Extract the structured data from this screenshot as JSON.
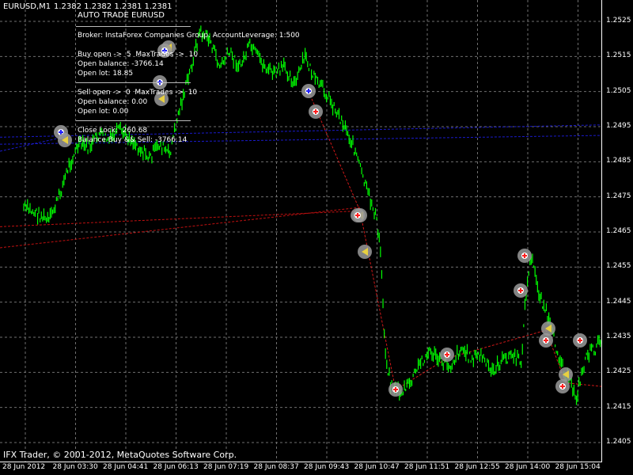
{
  "header": {
    "symbol": "EURUSD,M1",
    "ohlc": "1.2382 1.2382 1.2381 1.2381"
  },
  "ea": {
    "title": "AUTO TRADE EURUSD",
    "broker": "Broker: InstaForex Companies Group. AccountLeverage: 1:500",
    "buy_open": "Buy open ->  5  MaxTrades ->  10",
    "buy_balance": "Open balance: -3766.14",
    "buy_lot": "Open lot: 18.85",
    "sell_open": "Sell open ->  0  MaxTrades ->  10",
    "sell_balance": "Open balance: 0.00",
    "sell_lot": "Open lot: 0.00",
    "close_lock": "Close Lock:  260.68",
    "balance": "Balance Buy && Sell: -3766.14"
  },
  "copyright": "IFX Trader, © 2001-2012, MetaQuotes Software Corp.",
  "colors": {
    "bg": "#000000",
    "grid": "#6f6f6f",
    "candle": "#00ff00",
    "buy": "#1f1fff",
    "sell": "#ff2020"
  },
  "y_labels": [
    "1.2525",
    "1.2515",
    "1.2505",
    "1.2495",
    "1.2485",
    "1.2475",
    "1.2465",
    "1.2455",
    "1.2445",
    "1.2435",
    "1.2425",
    "1.2415",
    "1.2405"
  ],
  "x_labels": [
    "28 Jun 2012",
    "28 Jun 03:30",
    "28 Jun 04:41",
    "28 Jun 06:13",
    "28 Jun 07:19",
    "28 Jun 08:37",
    "28 Jun 09:43",
    "28 Jun 10:47",
    "28 Jun 11:51",
    "28 Jun 12:55",
    "28 Jun 14:00",
    "28 Jun 15:04"
  ],
  "chart_data": {
    "type": "line",
    "symbol": "EURUSD",
    "timeframe": "M1",
    "ylim": [
      1.24,
      1.253
    ],
    "grid": true,
    "categories": [
      "28 Jun 2012",
      "28 Jun 03:30",
      "28 Jun 04:41",
      "28 Jun 06:13",
      "28 Jun 07:19",
      "28 Jun 08:37",
      "28 Jun 09:43",
      "28 Jun 10:47",
      "28 Jun 11:51",
      "28 Jun 12:55",
      "28 Jun 14:00",
      "28 Jun 15:04"
    ],
    "series": [
      {
        "name": "",
        "path": [
          [
            0,
            1.2472
          ],
          [
            0.3,
            1.247
          ],
          [
            0.5,
            1.2468
          ],
          [
            0.7,
            1.2475
          ],
          [
            0.9,
            1.2484
          ],
          [
            1.1,
            1.249
          ],
          [
            1.3,
            1.2489
          ],
          [
            1.5,
            1.2493
          ],
          [
            1.7,
            1.2491
          ],
          [
            1.9,
            1.2494
          ],
          [
            2.1,
            1.2492
          ],
          [
            2.3,
            1.2489
          ],
          [
            2.5,
            1.2486
          ],
          [
            2.7,
            1.249
          ],
          [
            2.9,
            1.2487
          ],
          [
            3.1,
            1.25
          ],
          [
            3.3,
            1.251
          ],
          [
            3.5,
            1.2522
          ],
          [
            3.7,
            1.252
          ],
          [
            3.9,
            1.2512
          ],
          [
            4.1,
            1.2516
          ],
          [
            4.3,
            1.2512
          ],
          [
            4.5,
            1.2518
          ],
          [
            4.8,
            1.2512
          ],
          [
            5.0,
            1.251
          ],
          [
            5.2,
            1.2512
          ],
          [
            5.4,
            1.2507
          ],
          [
            5.6,
            1.2515
          ],
          [
            5.8,
            1.2508
          ],
          [
            6.0,
            1.2505
          ],
          [
            6.2,
            1.25
          ],
          [
            6.4,
            1.2495
          ],
          [
            6.6,
            1.2488
          ],
          [
            6.8,
            1.2478
          ],
          [
            7.0,
            1.247
          ],
          [
            7.1,
            1.246
          ],
          [
            7.2,
            1.243
          ],
          [
            7.3,
            1.2422
          ],
          [
            7.5,
            1.2419
          ],
          [
            7.7,
            1.2422
          ],
          [
            7.9,
            1.2428
          ],
          [
            8.1,
            1.2431
          ],
          [
            8.3,
            1.2428
          ],
          [
            8.5,
            1.2427
          ],
          [
            8.7,
            1.2432
          ],
          [
            8.9,
            1.2429
          ],
          [
            9.1,
            1.243
          ],
          [
            9.3,
            1.2425
          ],
          [
            9.5,
            1.2428
          ],
          [
            9.7,
            1.243
          ],
          [
            9.9,
            1.2428
          ],
          [
            10.0,
            1.2448
          ],
          [
            10.1,
            1.2458
          ],
          [
            10.25,
            1.2448
          ],
          [
            10.4,
            1.2442
          ],
          [
            10.6,
            1.2432
          ],
          [
            10.8,
            1.2424
          ],
          [
            11.0,
            1.2418
          ],
          [
            11.2,
            1.243
          ],
          [
            11.4,
            1.2432
          ],
          [
            11.6,
            1.2438
          ],
          [
            11.8,
            1.2434
          ]
        ]
      }
    ]
  }
}
